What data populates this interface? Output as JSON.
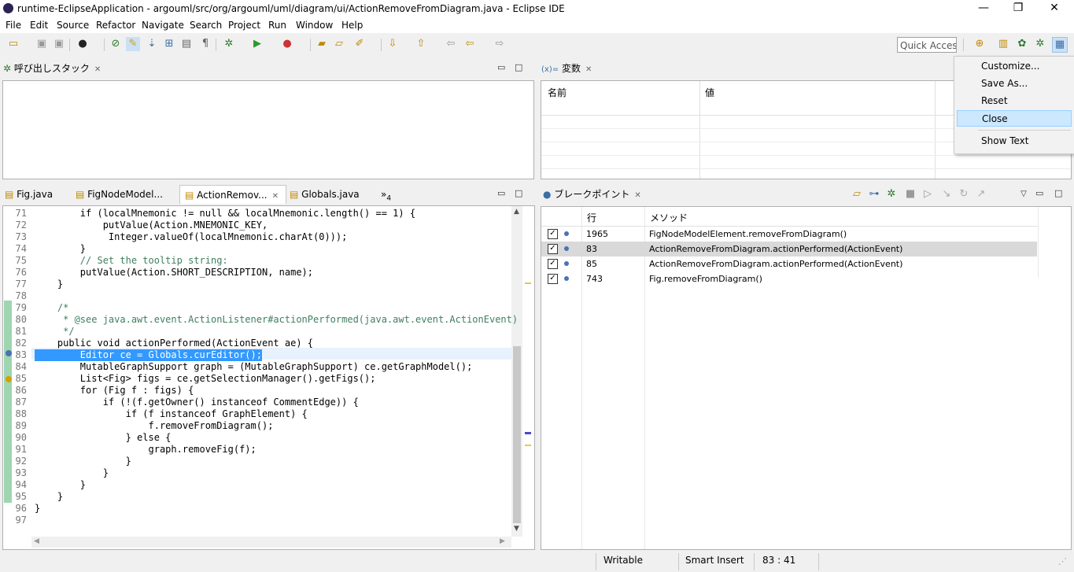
{
  "window": {
    "title": "runtime-EclipseApplication - argouml/src/org/argouml/uml/diagram/ui/ActionRemoveFromDiagram.java - Eclipse IDE",
    "minimize": "—",
    "maximize": "❐",
    "close": "✕"
  },
  "menu": [
    "File",
    "Edit",
    "Source",
    "Refactor",
    "Navigate",
    "Search",
    "Project",
    "Run",
    "Window",
    "Help"
  ],
  "toolbar": {
    "quick_access": "Quick Access"
  },
  "callstack": {
    "title": "呼び出しスタック"
  },
  "variables": {
    "title": "変数",
    "prefix": "(x)=",
    "col_name": "名前",
    "col_value": "値"
  },
  "editor": {
    "tabs": [
      "Fig.java",
      "FigNodeModel...",
      "ActionRemov...",
      "Globals.java"
    ],
    "overflow": "»",
    "overflow_count": "4",
    "lines": [
      {
        "n": "71",
        "t": "        if (localMnemonic != null && localMnemonic.length() == 1) {"
      },
      {
        "n": "72",
        "t": "            putValue(Action.MNEMONIC_KEY,"
      },
      {
        "n": "73",
        "t": "             Integer.valueOf(localMnemonic.charAt(0)));"
      },
      {
        "n": "74",
        "t": "        }"
      },
      {
        "n": "75",
        "t": "        // Set the tooltip string:"
      },
      {
        "n": "76",
        "t": "        putValue(Action.SHORT_DESCRIPTION, name);"
      },
      {
        "n": "77",
        "t": "    }"
      },
      {
        "n": "78",
        "t": ""
      },
      {
        "n": "79",
        "t": "    /*"
      },
      {
        "n": "80",
        "t": "     * @see java.awt.event.ActionListener#actionPerformed(java.awt.event.ActionEvent)"
      },
      {
        "n": "81",
        "t": "     */"
      },
      {
        "n": "82",
        "t": "    public void actionPerformed(ActionEvent ae) {"
      },
      {
        "n": "83",
        "t": "        Editor ce = Globals.curEditor();"
      },
      {
        "n": "84",
        "t": "        MutableGraphSupport graph = (MutableGraphSupport) ce.getGraphModel();"
      },
      {
        "n": "85",
        "t": "        List<Fig> figs = ce.getSelectionManager().getFigs();"
      },
      {
        "n": "86",
        "t": "        for (Fig f : figs) {"
      },
      {
        "n": "87",
        "t": "            if (!(f.getOwner() instanceof CommentEdge)) {"
      },
      {
        "n": "88",
        "t": "                if (f instanceof GraphElement) {"
      },
      {
        "n": "89",
        "t": "                    f.removeFromDiagram();"
      },
      {
        "n": "90",
        "t": "                } else {"
      },
      {
        "n": "91",
        "t": "                    graph.removeFig(f);"
      },
      {
        "n": "92",
        "t": "                }"
      },
      {
        "n": "93",
        "t": "            }"
      },
      {
        "n": "94",
        "t": "        }"
      },
      {
        "n": "95",
        "t": "    }"
      },
      {
        "n": "96",
        "t": "}"
      },
      {
        "n": "97",
        "t": ""
      }
    ]
  },
  "breakpoints": {
    "title": "ブレークポイント",
    "col_line": "行",
    "col_method": "メソッド",
    "rows": [
      {
        "line": "1965",
        "method": "FigNodeModelElement.removeFromDiagram()",
        "checked": true
      },
      {
        "line": "83",
        "method": "ActionRemoveFromDiagram.actionPerformed(ActionEvent)",
        "checked": true
      },
      {
        "line": "85",
        "method": "ActionRemoveFromDiagram.actionPerformed(ActionEvent)",
        "checked": true
      },
      {
        "line": "743",
        "method": "Fig.removeFromDiagram()",
        "checked": true
      }
    ]
  },
  "popup": {
    "items": [
      "Customize...",
      "Save As...",
      "Reset",
      "Close",
      "Show Text"
    ]
  },
  "status": {
    "writable": "Writable",
    "insert": "Smart Insert",
    "position": "83 : 41"
  }
}
